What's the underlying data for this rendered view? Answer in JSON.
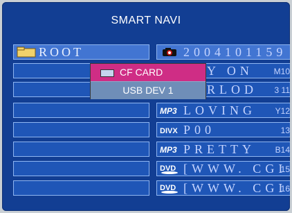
{
  "title": "SMART NAVI",
  "left_panel": {
    "root_label": "ROOT",
    "rows": 8
  },
  "right_panel": {
    "items": [
      {
        "icon": "camera-icon",
        "name": "2004101159",
        "num": ""
      },
      {
        "icon": "none",
        "name": "Y ON",
        "num": "M10"
      },
      {
        "icon": "none",
        "name": "RLOD",
        "num": "3 11"
      },
      {
        "icon": "mp3-icon",
        "name": "LOVING",
        "num": "Y12"
      },
      {
        "icon": "divx-icon",
        "name": "P00",
        "num": "13"
      },
      {
        "icon": "mp3-icon",
        "name": "PRETTY",
        "num": "B14"
      },
      {
        "icon": "dvd-icon",
        "name": "[WWW. CGI",
        "num": "15"
      },
      {
        "icon": "dvd-icon",
        "name": "[WWW. CGI",
        "num": "16"
      }
    ]
  },
  "popup": {
    "items": [
      {
        "label": "CF CARD",
        "selected": true
      },
      {
        "label": "USB DEV 1",
        "selected": false
      }
    ]
  }
}
